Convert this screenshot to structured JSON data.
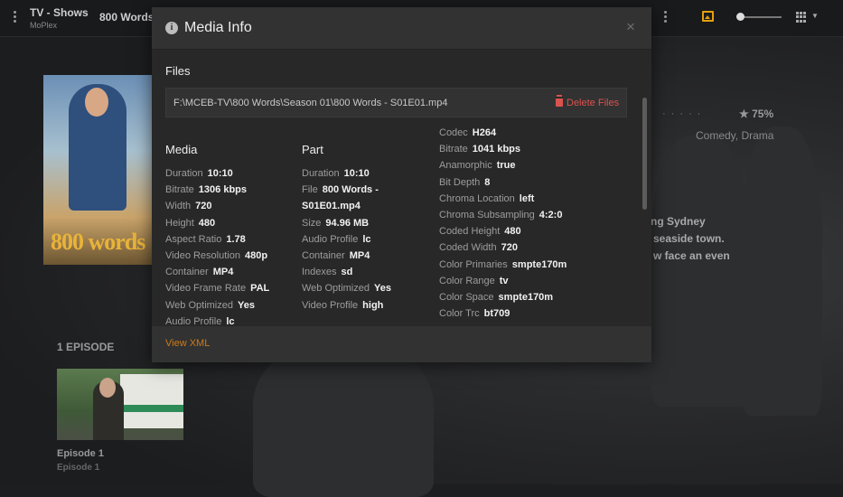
{
  "app": {
    "title": "TV - Shows",
    "subtitle": "MoPlex",
    "breadcrumb": "800 Words"
  },
  "show": {
    "poster_logo": "800 words",
    "rating": "★ 75%",
    "genre": "Comedy, Drama",
    "summary_lines": [
      "ng Sydney",
      "seaside town.",
      "w face an even"
    ],
    "episode_header": "1 EPISODE",
    "episode_title": "Episode 1",
    "episode_sub": "Episode 1"
  },
  "modal": {
    "title": "Media Info",
    "close_glyph": "×",
    "info_glyph": "i",
    "files_label": "Files",
    "file_path": "F:\\MCEB-TV\\800 Words\\Season 01\\800 Words - S01E01.mp4",
    "delete_label": "Delete Files",
    "footer_link": "View XML",
    "media": {
      "heading": "Media",
      "rows": [
        {
          "k": "Duration",
          "v": "10:10"
        },
        {
          "k": "Bitrate",
          "v": "1306 kbps"
        },
        {
          "k": "Width",
          "v": "720"
        },
        {
          "k": "Height",
          "v": "480"
        },
        {
          "k": "Aspect Ratio",
          "v": "1.78"
        },
        {
          "k": "Video Resolution",
          "v": "480p"
        },
        {
          "k": "Container",
          "v": "MP4"
        },
        {
          "k": "Video Frame Rate",
          "v": "PAL"
        },
        {
          "k": "Web Optimized",
          "v": "Yes"
        },
        {
          "k": "Audio Profile",
          "v": "lc"
        }
      ]
    },
    "part": {
      "heading": "Part",
      "rows": [
        {
          "k": "Duration",
          "v": "10:10"
        },
        {
          "k": "File",
          "v": "800 Words -",
          "v2": "S01E01.mp4"
        },
        {
          "k": "Size",
          "v": "94.96 MB"
        },
        {
          "k": "Audio Profile",
          "v": "lc"
        },
        {
          "k": "Container",
          "v": "MP4"
        },
        {
          "k": "Indexes",
          "v": "sd"
        },
        {
          "k": "Web Optimized",
          "v": "Yes"
        },
        {
          "k": "Video Profile",
          "v": "high"
        }
      ]
    },
    "stream": {
      "rows": [
        {
          "k": "Codec",
          "v": "H264"
        },
        {
          "k": "Bitrate",
          "v": "1041 kbps"
        },
        {
          "k": "Anamorphic",
          "v": "true"
        },
        {
          "k": "Bit Depth",
          "v": "8"
        },
        {
          "k": "Chroma Location",
          "v": "left"
        },
        {
          "k": "Chroma Subsampling",
          "v": "4:2:0"
        },
        {
          "k": "Coded Height",
          "v": "480"
        },
        {
          "k": "Coded Width",
          "v": "720"
        },
        {
          "k": "Color Primaries",
          "v": "smpte170m"
        },
        {
          "k": "Color Range",
          "v": "tv"
        },
        {
          "k": "Color Space",
          "v": "smpte170m"
        },
        {
          "k": "Color Trc",
          "v": "bt709"
        }
      ]
    }
  },
  "colors": {
    "accent_orange": "#cc7b19",
    "delete_red": "#d9534f",
    "photo_icon": "#e5a00d"
  }
}
